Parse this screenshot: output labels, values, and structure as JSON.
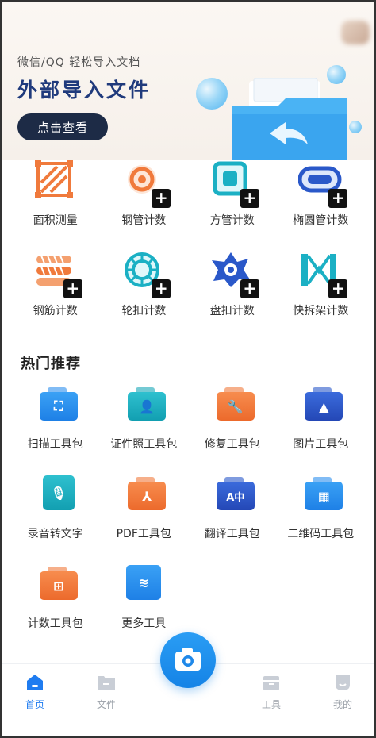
{
  "banner": {
    "subtitle": "微信/QQ 轻松导入文档",
    "title": "外部导入文件",
    "cta": "点击查看"
  },
  "tools_row1": [
    {
      "label": "面积测量",
      "icon": "area-measure-icon"
    },
    {
      "label": "钢管计数",
      "icon": "steel-pipe-icon"
    },
    {
      "label": "方管计数",
      "icon": "square-pipe-icon"
    },
    {
      "label": "椭圆管计数",
      "icon": "oval-pipe-icon"
    }
  ],
  "tools_row2": [
    {
      "label": "钢筋计数",
      "icon": "rebar-icon"
    },
    {
      "label": "轮扣计数",
      "icon": "wheel-buckle-icon"
    },
    {
      "label": "盘扣计数",
      "icon": "disc-buckle-icon"
    },
    {
      "label": "快拆架计数",
      "icon": "quick-frame-icon"
    }
  ],
  "hot": {
    "title": "热门推荐",
    "row1": [
      "扫描工具包",
      "证件照工具包",
      "修复工具包",
      "图片工具包"
    ],
    "row2": [
      "录音转文字",
      "PDF工具包",
      "翻译工具包",
      "二维码工具包"
    ],
    "row3": [
      "计数工具包",
      "更多工具"
    ]
  },
  "tabbar": {
    "home": "首页",
    "files": "文件",
    "tools": "工具",
    "mine": "我的"
  },
  "colors": {
    "brand_blue": "#1f7cf0",
    "orange": "#f07a3c",
    "teal": "#1bb0c4",
    "navy": "#1f3a7c"
  }
}
